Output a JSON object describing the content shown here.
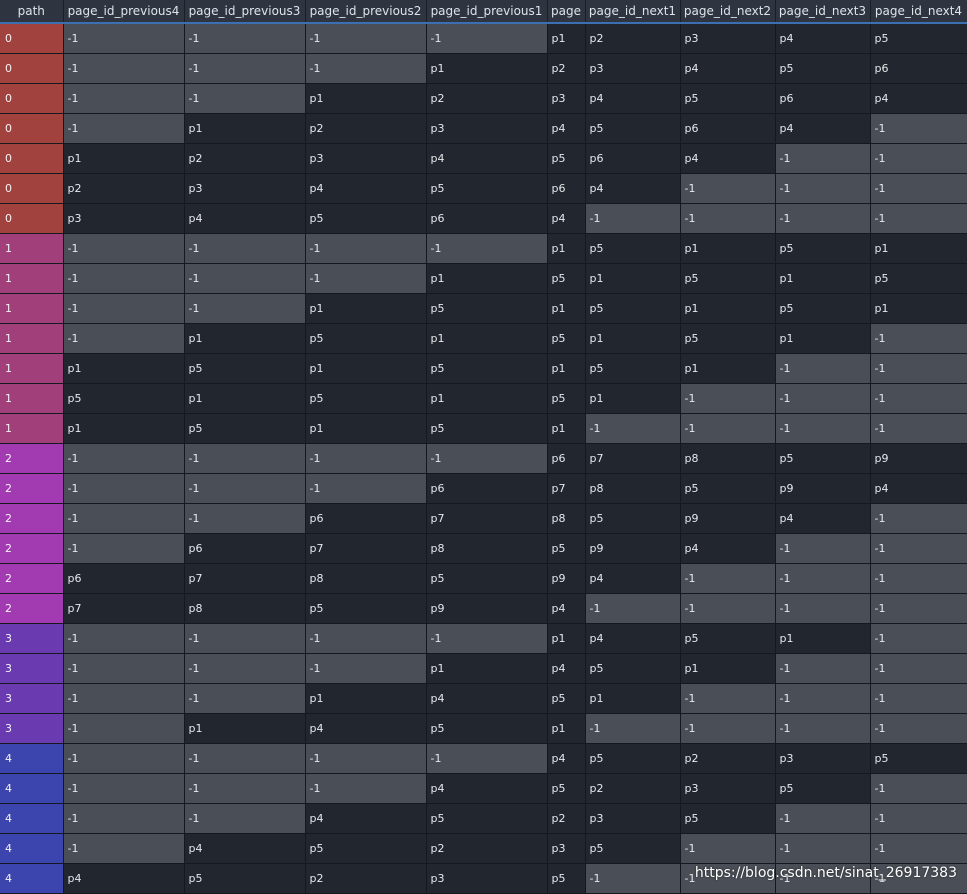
{
  "columns": [
    "path",
    "page_id_previous4",
    "page_id_previous3",
    "page_id_previous2",
    "page_id_previous1",
    "page",
    "page_id_next1",
    "page_id_next2",
    "page_id_next3",
    "page_id_next4"
  ],
  "path_colors": {
    "0": "#a2423f",
    "1": "#a03f79",
    "2": "#a23ab1",
    "3": "#6a3ab0",
    "4": "#3c45ae"
  },
  "rows": [
    [
      "0",
      "-1",
      "-1",
      "-1",
      "-1",
      "p1",
      "p2",
      "p3",
      "p4",
      "p5"
    ],
    [
      "0",
      "-1",
      "-1",
      "-1",
      "p1",
      "p2",
      "p3",
      "p4",
      "p5",
      "p6"
    ],
    [
      "0",
      "-1",
      "-1",
      "p1",
      "p2",
      "p3",
      "p4",
      "p5",
      "p6",
      "p4"
    ],
    [
      "0",
      "-1",
      "p1",
      "p2",
      "p3",
      "p4",
      "p5",
      "p6",
      "p4",
      "-1"
    ],
    [
      "0",
      "p1",
      "p2",
      "p3",
      "p4",
      "p5",
      "p6",
      "p4",
      "-1",
      "-1"
    ],
    [
      "0",
      "p2",
      "p3",
      "p4",
      "p5",
      "p6",
      "p4",
      "-1",
      "-1",
      "-1"
    ],
    [
      "0",
      "p3",
      "p4",
      "p5",
      "p6",
      "p4",
      "-1",
      "-1",
      "-1",
      "-1"
    ],
    [
      "1",
      "-1",
      "-1",
      "-1",
      "-1",
      "p1",
      "p5",
      "p1",
      "p5",
      "p1"
    ],
    [
      "1",
      "-1",
      "-1",
      "-1",
      "p1",
      "p5",
      "p1",
      "p5",
      "p1",
      "p5"
    ],
    [
      "1",
      "-1",
      "-1",
      "p1",
      "p5",
      "p1",
      "p5",
      "p1",
      "p5",
      "p1"
    ],
    [
      "1",
      "-1",
      "p1",
      "p5",
      "p1",
      "p5",
      "p1",
      "p5",
      "p1",
      "-1"
    ],
    [
      "1",
      "p1",
      "p5",
      "p1",
      "p5",
      "p1",
      "p5",
      "p1",
      "-1",
      "-1"
    ],
    [
      "1",
      "p5",
      "p1",
      "p5",
      "p1",
      "p5",
      "p1",
      "-1",
      "-1",
      "-1"
    ],
    [
      "1",
      "p1",
      "p5",
      "p1",
      "p5",
      "p1",
      "-1",
      "-1",
      "-1",
      "-1"
    ],
    [
      "2",
      "-1",
      "-1",
      "-1",
      "-1",
      "p6",
      "p7",
      "p8",
      "p5",
      "p9"
    ],
    [
      "2",
      "-1",
      "-1",
      "-1",
      "p6",
      "p7",
      "p8",
      "p5",
      "p9",
      "p4"
    ],
    [
      "2",
      "-1",
      "-1",
      "p6",
      "p7",
      "p8",
      "p5",
      "p9",
      "p4",
      "-1"
    ],
    [
      "2",
      "-1",
      "p6",
      "p7",
      "p8",
      "p5",
      "p9",
      "p4",
      "-1",
      "-1"
    ],
    [
      "2",
      "p6",
      "p7",
      "p8",
      "p5",
      "p9",
      "p4",
      "-1",
      "-1",
      "-1"
    ],
    [
      "2",
      "p7",
      "p8",
      "p5",
      "p9",
      "p4",
      "-1",
      "-1",
      "-1",
      "-1"
    ],
    [
      "3",
      "-1",
      "-1",
      "-1",
      "-1",
      "p1",
      "p4",
      "p5",
      "p1",
      "-1"
    ],
    [
      "3",
      "-1",
      "-1",
      "-1",
      "p1",
      "p4",
      "p5",
      "p1",
      "-1",
      "-1"
    ],
    [
      "3",
      "-1",
      "-1",
      "p1",
      "p4",
      "p5",
      "p1",
      "-1",
      "-1",
      "-1"
    ],
    [
      "3",
      "-1",
      "p1",
      "p4",
      "p5",
      "p1",
      "-1",
      "-1",
      "-1",
      "-1"
    ],
    [
      "4",
      "-1",
      "-1",
      "-1",
      "-1",
      "p4",
      "p5",
      "p2",
      "p3",
      "p5"
    ],
    [
      "4",
      "-1",
      "-1",
      "-1",
      "p4",
      "p5",
      "p2",
      "p3",
      "p5",
      "-1"
    ],
    [
      "4",
      "-1",
      "-1",
      "p4",
      "p5",
      "p2",
      "p3",
      "p5",
      "-1",
      "-1"
    ],
    [
      "4",
      "-1",
      "p4",
      "p5",
      "p2",
      "p3",
      "p5",
      "-1",
      "-1",
      "-1"
    ],
    [
      "4",
      "p4",
      "p5",
      "p2",
      "p3",
      "p5",
      "-1",
      "-1",
      "-1",
      "-1"
    ]
  ],
  "watermark": "https://blog.csdn.net/sinat_26917383"
}
